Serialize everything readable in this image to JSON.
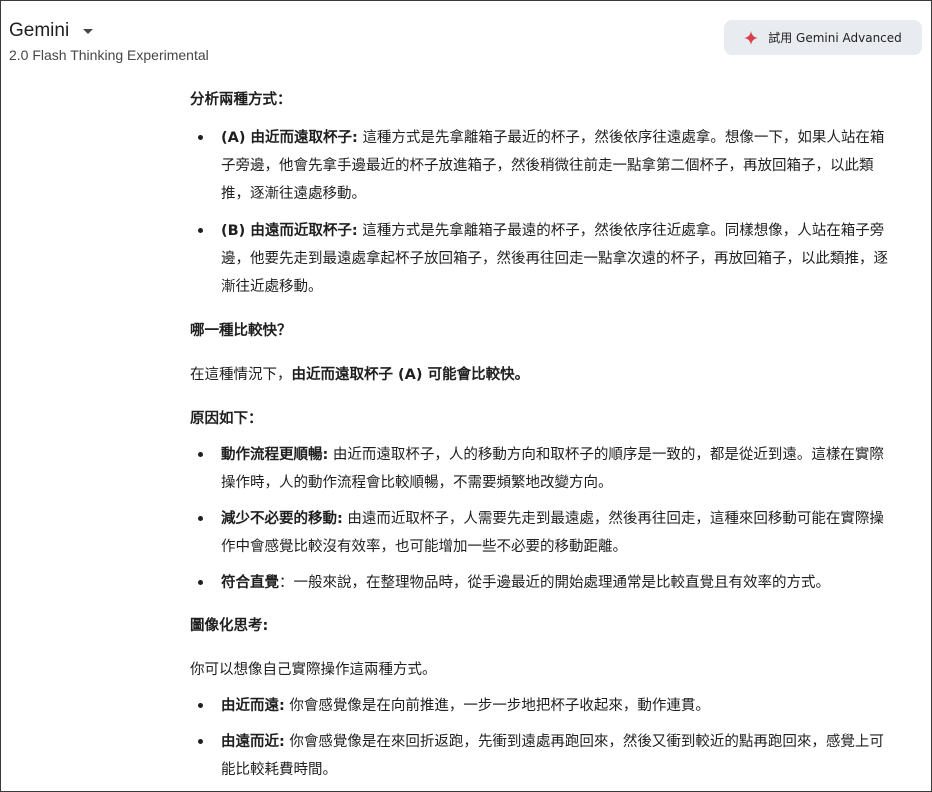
{
  "header": {
    "model_name": "Gemini",
    "model_variant": "2.0 Flash Thinking Experimental",
    "try_button_label": "試用 Gemini Advanced",
    "try_button_icon": "sparkle-icon",
    "accent_color": "#d93f4a"
  },
  "response": {
    "section1_heading": "分析兩種方式：",
    "section1_items": [
      {
        "label": "(A) 由近而遠取杯子:",
        "text": "這種方式是先拿離箱子最近的杯子，然後依序往遠處拿。想像一下，如果人站在箱子旁邊，他會先拿手邊最近的杯子放進箱子，然後稍微往前走一點拿第二個杯子，再放回箱子，以此類推，逐漸往遠處移動。"
      },
      {
        "label": "(B) 由遠而近取杯子:",
        "text": "這種方式是先拿離箱子最遠的杯子，然後依序往近處拿。同樣想像，人站在箱子旁邊，他要先走到最遠處拿起杯子放回箱子，然後再往回走一點拿次遠的杯子，再放回箱子，以此類推，逐漸往近處移動。"
      }
    ],
    "section2_heading": "哪一種比較快？",
    "conclusion_prefix": "在這種情況下，",
    "conclusion_bold": "由近而遠取杯子 (A) 可能會比較快。",
    "section3_heading": "原因如下：",
    "section3_items": [
      {
        "label": "動作流程更順暢:",
        "text": "由近而遠取杯子，人的移動方向和取杯子的順序是一致的，都是從近到遠。這樣在實際操作時，人的動作流程會比較順暢，不需要頻繁地改變方向。"
      },
      {
        "label": "減少不必要的移動:",
        "text": "由遠而近取杯子，人需要先走到最遠處，然後再往回走，這種來回移動可能在實際操作中會感覺比較沒有效率，也可能增加一些不必要的移動距離。"
      },
      {
        "label": "符合直覺",
        "text": "：一般來說，在整理物品時，從手邊最近的開始處理通常是比較直覺且有效率的方式。"
      }
    ],
    "section4_heading": "圖像化思考:",
    "section4_intro": "你可以想像自己實際操作這兩種方式。",
    "section4_items": [
      {
        "label": "由近而遠:",
        "text": "你會感覺像是在向前推進，一步一步地把杯子收起來，動作連貫。"
      },
      {
        "label": "由遠而近:",
        "text": "你會感覺像是在來回折返跑，先衝到遠處再跑回來，然後又衝到較近的點再跑回來，感覺上可能比較耗費時間。"
      }
    ]
  }
}
